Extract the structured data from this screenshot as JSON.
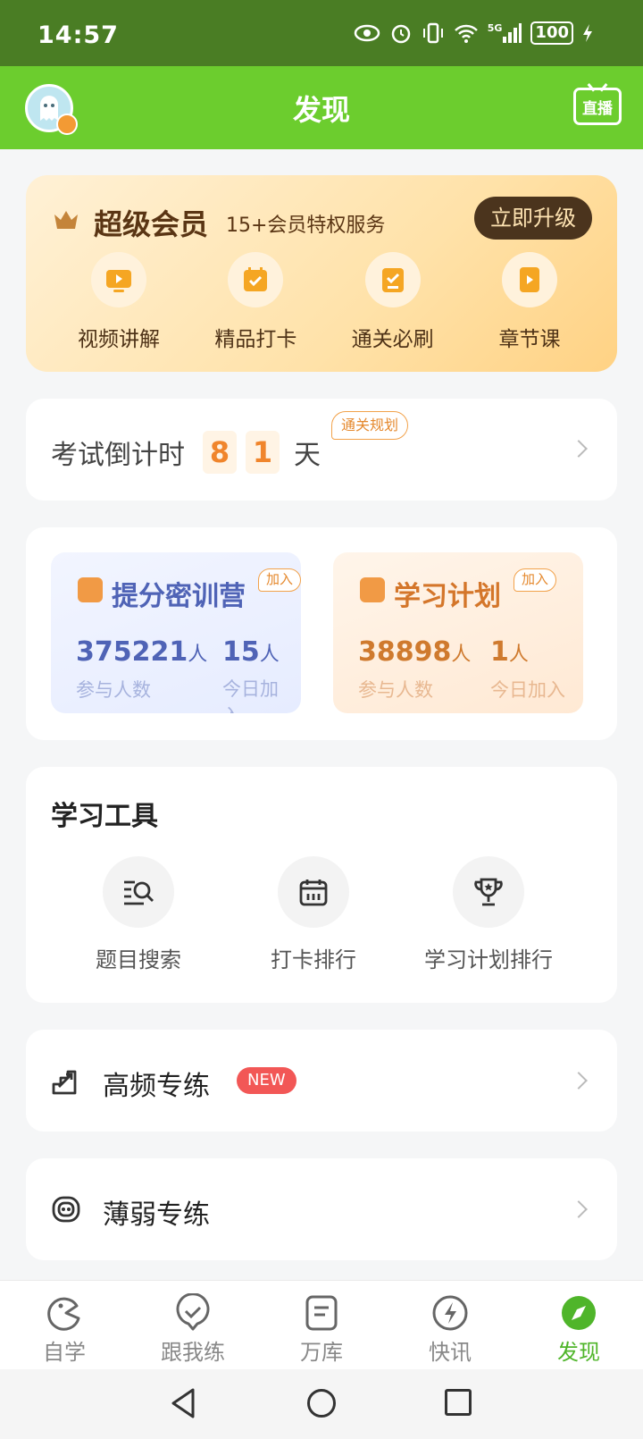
{
  "status": {
    "time": "14:57",
    "signal": "5G",
    "battery": "100"
  },
  "header": {
    "title": "发现",
    "live_label": "直播"
  },
  "vip": {
    "title": "超级会员",
    "subtitle": "15+会员特权服务",
    "upgrade_label": "立即升级",
    "items": [
      {
        "label": "视频讲解",
        "icon": "video-icon"
      },
      {
        "label": "精品打卡",
        "icon": "checkin-icon"
      },
      {
        "label": "通关必刷",
        "icon": "exercise-icon"
      },
      {
        "label": "章节课",
        "icon": "chapter-icon"
      }
    ]
  },
  "countdown": {
    "label": "考试倒计时",
    "digits": [
      "8",
      "1"
    ],
    "unit": "天",
    "plan_tag": "通关规划"
  },
  "camps": [
    {
      "title": "提分密训营",
      "join": "加入",
      "participants": "375221",
      "participants_unit": "人",
      "participants_caption": "参与人数",
      "today": "15",
      "today_unit": "人",
      "today_caption": "今日加入"
    },
    {
      "title": "学习计划",
      "join": "加入",
      "participants": "38898",
      "participants_unit": "人",
      "participants_caption": "参与人数",
      "today": "1",
      "today_unit": "人",
      "today_caption": "今日加入"
    }
  ],
  "tools": {
    "title": "学习工具",
    "items": [
      {
        "label": "题目搜索",
        "icon": "search-list-icon"
      },
      {
        "label": "打卡排行",
        "icon": "calendar-icon"
      },
      {
        "label": "学习计划排行",
        "icon": "trophy-icon"
      }
    ]
  },
  "practice": [
    {
      "label": "高频专练",
      "badge": "NEW",
      "icon": "stairs-icon"
    },
    {
      "label": "薄弱专练",
      "icon": "target-icon"
    }
  ],
  "tabs": [
    {
      "label": "自学",
      "icon": "self-study-icon",
      "active": false
    },
    {
      "label": "跟我练",
      "icon": "practice-icon",
      "active": false
    },
    {
      "label": "万库",
      "icon": "library-icon",
      "active": false
    },
    {
      "label": "快讯",
      "icon": "flash-icon",
      "active": false
    },
    {
      "label": "发现",
      "icon": "compass-icon",
      "active": true
    }
  ],
  "colors": {
    "header": "#6ccd2e",
    "status_bar": "#4a7d24",
    "accent": "#f0852c",
    "active_tab": "#4fb52a"
  }
}
